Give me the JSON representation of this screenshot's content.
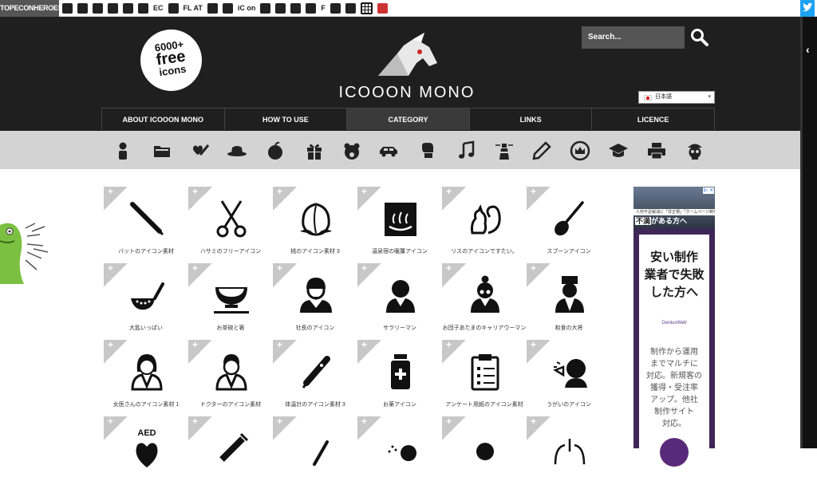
{
  "topbar": {
    "brand": "TOPECONHEROES",
    "text_icons": [
      "EC",
      "FL AT",
      "iC on",
      "F"
    ]
  },
  "header": {
    "badge": {
      "line1": "6000+",
      "line2": "free",
      "line3": "icons"
    },
    "site_title": "ICOOON MONO",
    "search_placeholder": "Search...",
    "language": "日本語"
  },
  "nav": [
    {
      "label": "ABOUT ICOOON MONO"
    },
    {
      "label": "HOW TO USE"
    },
    {
      "label": "CATEGORY",
      "active": true
    },
    {
      "label": "LINKS"
    },
    {
      "label": "LICENCE"
    }
  ],
  "categories": [
    "person-icon",
    "folder-icon",
    "health-icon",
    "hat-icon",
    "apple-icon",
    "gift-icon",
    "bear-icon",
    "car-icon",
    "boxing-icon",
    "music-icon",
    "lighthouse-icon",
    "pencil-icon",
    "crown-icon",
    "graduation-icon",
    "printer-icon",
    "skull-icon"
  ],
  "icons": [
    {
      "label": "バットのアイコン素材",
      "icon": "bat-icon"
    },
    {
      "label": "ハサミのフリーアイコン",
      "icon": "scissors-icon"
    },
    {
      "label": "桃のアイコン素材 3",
      "icon": "peach-icon"
    },
    {
      "label": "温泉宿の暖簾アイコン",
      "icon": "onsen-icon"
    },
    {
      "label": "リスのアイコンですたい。",
      "icon": "squirrel-icon"
    },
    {
      "label": "スプーンアイコン",
      "icon": "spoon-icon"
    },
    {
      "label": "大匙いっぱい",
      "icon": "ladle-icon"
    },
    {
      "label": "お茶碗と箸",
      "icon": "rice-bowl-icon"
    },
    {
      "label": "社長のアイコン",
      "icon": "president-icon"
    },
    {
      "label": "サラリーマン",
      "icon": "salaryman-icon"
    },
    {
      "label": "お団子あたまのキャリアウーマン",
      "icon": "career-woman-icon"
    },
    {
      "label": "和食の大将",
      "icon": "chef-icon"
    },
    {
      "label": "女医さんのアイコン素材 1",
      "icon": "female-doctor-icon"
    },
    {
      "label": "ドクターのアイコン素材",
      "icon": "doctor-icon"
    },
    {
      "label": "体温計のアイコン素材 3",
      "icon": "thermometer-icon"
    },
    {
      "label": "お薬アイコン",
      "icon": "medicine-icon"
    },
    {
      "label": "アンケート用紙のアイコン素材",
      "icon": "clipboard-icon"
    },
    {
      "label": "うがいのアイコン",
      "icon": "gargle-icon"
    },
    {
      "label": "",
      "icon": "aed-icon",
      "art_text": "AED"
    },
    {
      "label": "",
      "icon": "syringe-icon"
    },
    {
      "label": "",
      "icon": "thermometer-2-icon"
    },
    {
      "label": "",
      "icon": "spray-icon"
    },
    {
      "label": "",
      "icon": "person-2-icon"
    },
    {
      "label": "",
      "icon": "lungs-icon"
    }
  ],
  "ad": {
    "top_strip": "人材不足解消に「非正規」「ホームページ制作会社」に",
    "top_head_hl": "不満",
    "top_head_rest": "がある方へ",
    "ad_choices": "i▷ ✕",
    "headline_1": "安い制作",
    "headline_2": "業者で失敗",
    "headline_3": "した方へ",
    "logo": "GeniusWeb",
    "body_1": "制作から運用",
    "body_2": "までマルチに",
    "body_3": "対応。新規客の",
    "body_4": "獲得・受注率",
    "body_5": "アップ。他社",
    "body_6": "制作サイト",
    "body_7": "対応。"
  },
  "colors": {
    "header_bg": "#1f1f1f",
    "nav_active": "#3a3a3a",
    "category_bar": "#d3d3d3",
    "ad_bg": "#3e2757",
    "twitter": "#1da1f2"
  }
}
